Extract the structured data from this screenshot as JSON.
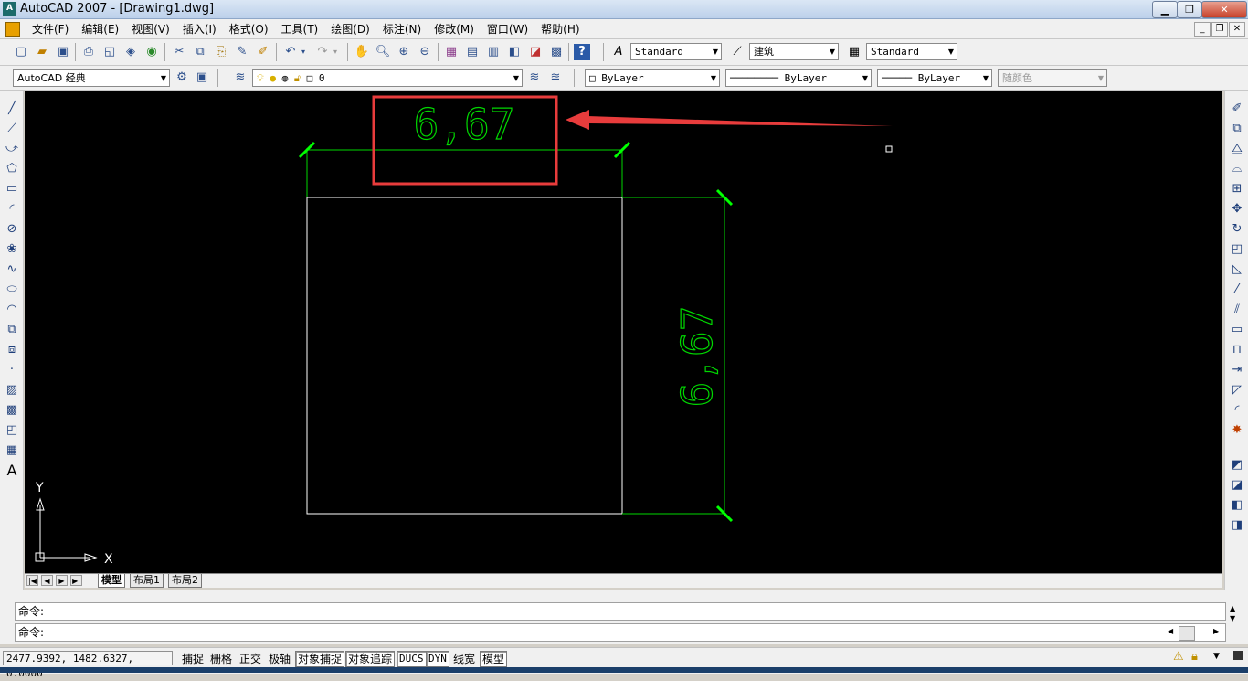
{
  "window": {
    "title": "AutoCAD 2007 - [Drawing1.dwg]",
    "app_icon_label": "A"
  },
  "menu": {
    "items": [
      "文件(F)",
      "编辑(E)",
      "视图(V)",
      "插入(I)",
      "格式(O)",
      "工具(T)",
      "绘图(D)",
      "标注(N)",
      "修改(M)",
      "窗口(W)",
      "帮助(H)"
    ]
  },
  "toolbar": {
    "text_style": "Standard",
    "dim_style": "建筑",
    "table_style": "Standard",
    "workspace": "AutoCAD 经典",
    "layer": "0",
    "color": "ByLayer",
    "linetype": "ByLayer",
    "lineweight": "ByLayer",
    "plot_style": "随颜色"
  },
  "drawing": {
    "horizontal_dim_text": "6,67",
    "vertical_dim_text": "6,67",
    "ucs_x_label": "X",
    "ucs_y_label": "Y",
    "colors": {
      "background": "#000000",
      "geometry": "#ffffff",
      "dimension": "#00d800",
      "dimension_tick": "#00ff00",
      "highlight_box": "#e83c3c",
      "arrow": "#e83c3c"
    }
  },
  "layout_tabs": [
    "模型",
    "布局1",
    "布局2"
  ],
  "command": {
    "line1": "命令:",
    "line2": "命令:"
  },
  "status": {
    "coordinates": "2477.9392, 1482.6327, 0.0000",
    "buttons": [
      {
        "label": "捕捉",
        "on": false
      },
      {
        "label": "栅格",
        "on": false
      },
      {
        "label": "正交",
        "on": false
      },
      {
        "label": "极轴",
        "on": false
      },
      {
        "label": "对象捕捉",
        "on": true
      },
      {
        "label": "对象追踪",
        "on": true
      },
      {
        "label": "DUCS",
        "on": true
      },
      {
        "label": "DYN",
        "on": true
      },
      {
        "label": "线宽",
        "on": false
      },
      {
        "label": "模型",
        "on": true
      }
    ]
  }
}
